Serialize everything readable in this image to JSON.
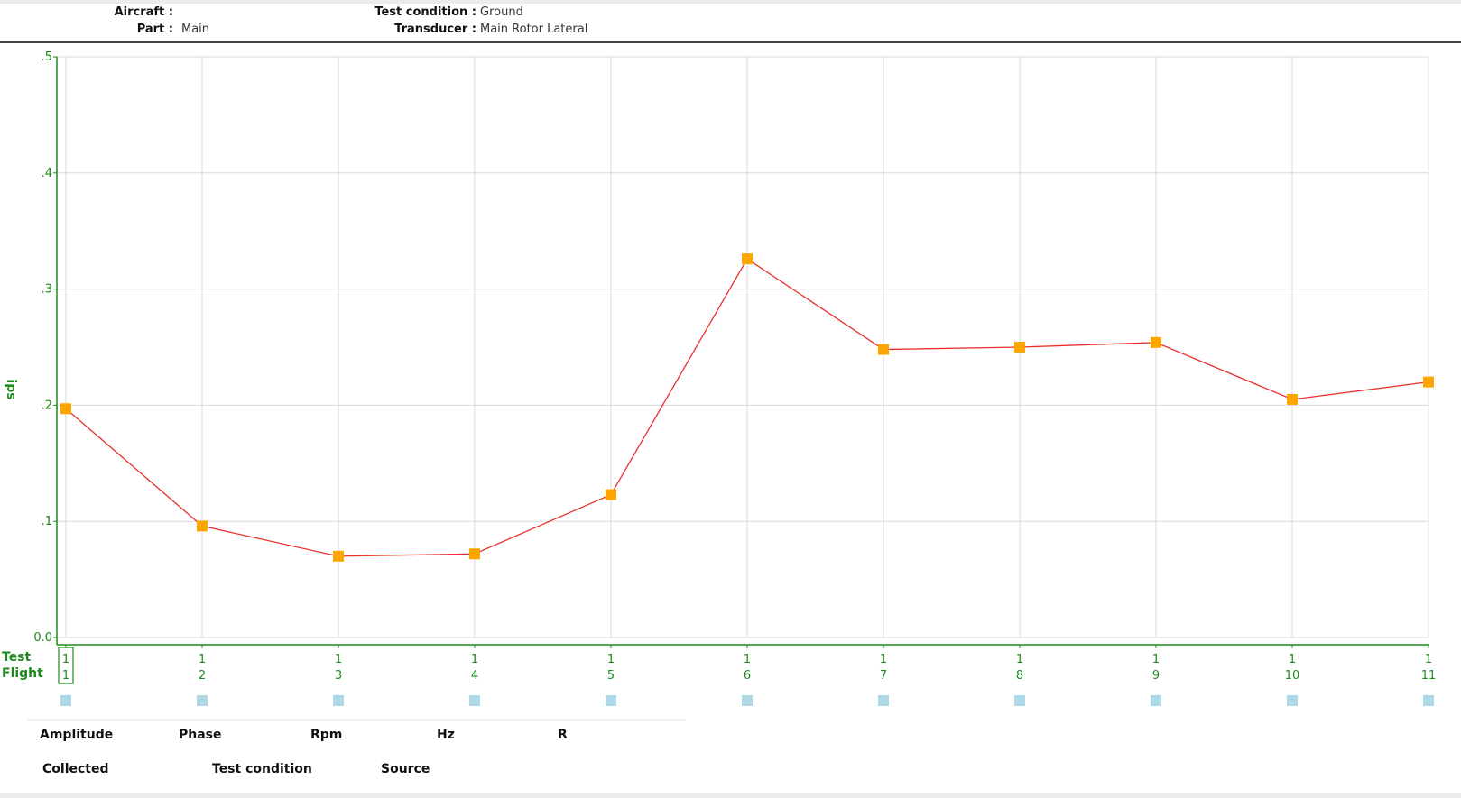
{
  "header": {
    "aircraft_label": "Aircraft :",
    "aircraft_value": "",
    "part_label": "Part :",
    "part_value": "Main",
    "test_condition_label": "Test condition :",
    "test_condition_value": "Ground",
    "transducer_label": "Transducer :",
    "transducer_value": "Main Rotor Lateral"
  },
  "footer": {
    "amplitude": "Amplitude",
    "phase": "Phase",
    "rpm": "Rpm",
    "hz": "Hz",
    "r": "R",
    "collected": "Collected",
    "test_condition": "Test condition",
    "source": "Source"
  },
  "colors": {
    "axis": "#1e8a1e",
    "line": "#e8322b",
    "marker": "#ffa500",
    "indicator": "#add8e6",
    "grid": "#d9d9d9"
  },
  "chart_data": {
    "type": "line",
    "title": "",
    "ylabel": "ips",
    "ylim": [
      0,
      0.5
    ],
    "yticks": [
      ".5",
      ".4",
      ".3",
      ".2",
      ".1",
      "0.0"
    ],
    "row_labels": [
      "Test",
      "Flight"
    ],
    "categories_test": [
      "1",
      "1",
      "1",
      "1",
      "1",
      "1",
      "1",
      "1",
      "1",
      "1",
      "1"
    ],
    "categories_flight": [
      "1",
      "2",
      "3",
      "4",
      "5",
      "6",
      "7",
      "8",
      "9",
      "10",
      "11"
    ],
    "values": [
      0.197,
      0.096,
      0.07,
      0.072,
      0.123,
      0.326,
      0.248,
      0.25,
      0.254,
      0.205,
      0.22
    ],
    "grid": true,
    "selected_index": 0
  }
}
